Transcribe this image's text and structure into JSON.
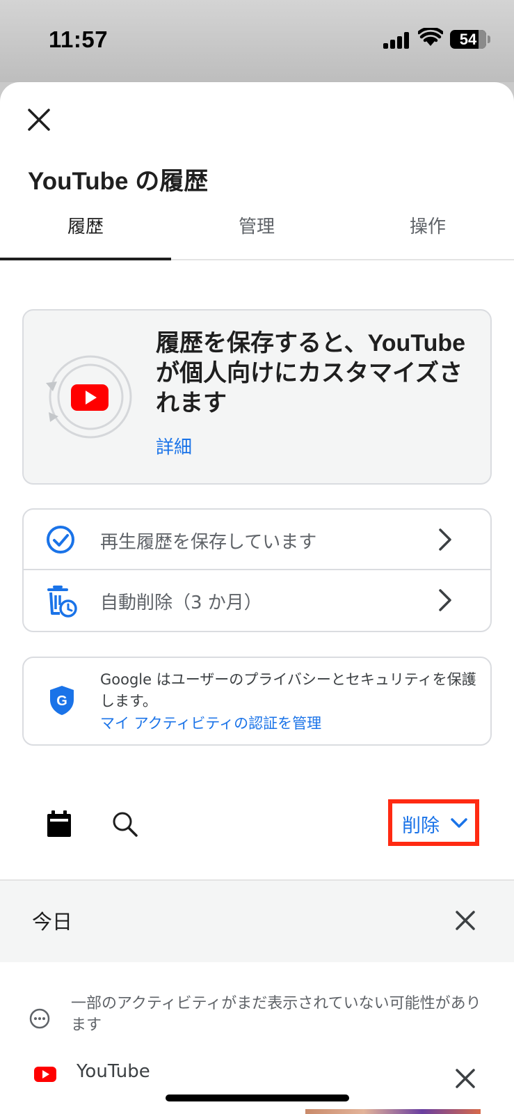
{
  "status": {
    "time": "11:57",
    "battery": "54"
  },
  "page": {
    "title": "YouTube の履歴"
  },
  "tabs": [
    {
      "label": "履歴",
      "active": true
    },
    {
      "label": "管理",
      "active": false
    },
    {
      "label": "操作",
      "active": false
    }
  ],
  "promo": {
    "title": "履歴を保存すると、YouTube が個人向けにカスタマイズされます",
    "link": "詳細"
  },
  "settings": {
    "history_saving": "再生履歴を保存しています",
    "auto_delete": "自動削除（3 か月）"
  },
  "privacy": {
    "text": "Google はユーザーのプライバシーとセキュリティを保護します。",
    "link": "マイ アクティビティの認証を管理"
  },
  "toolbar": {
    "delete_label": "削除"
  },
  "history": {
    "day_label": "今日",
    "notice": "一部のアクティビティがまだ表示されていない可能性があります",
    "item_source": "YouTube"
  },
  "colors": {
    "accent": "#1a73e8",
    "highlight": "#ff2a12",
    "youtube_red": "#ff0000"
  }
}
